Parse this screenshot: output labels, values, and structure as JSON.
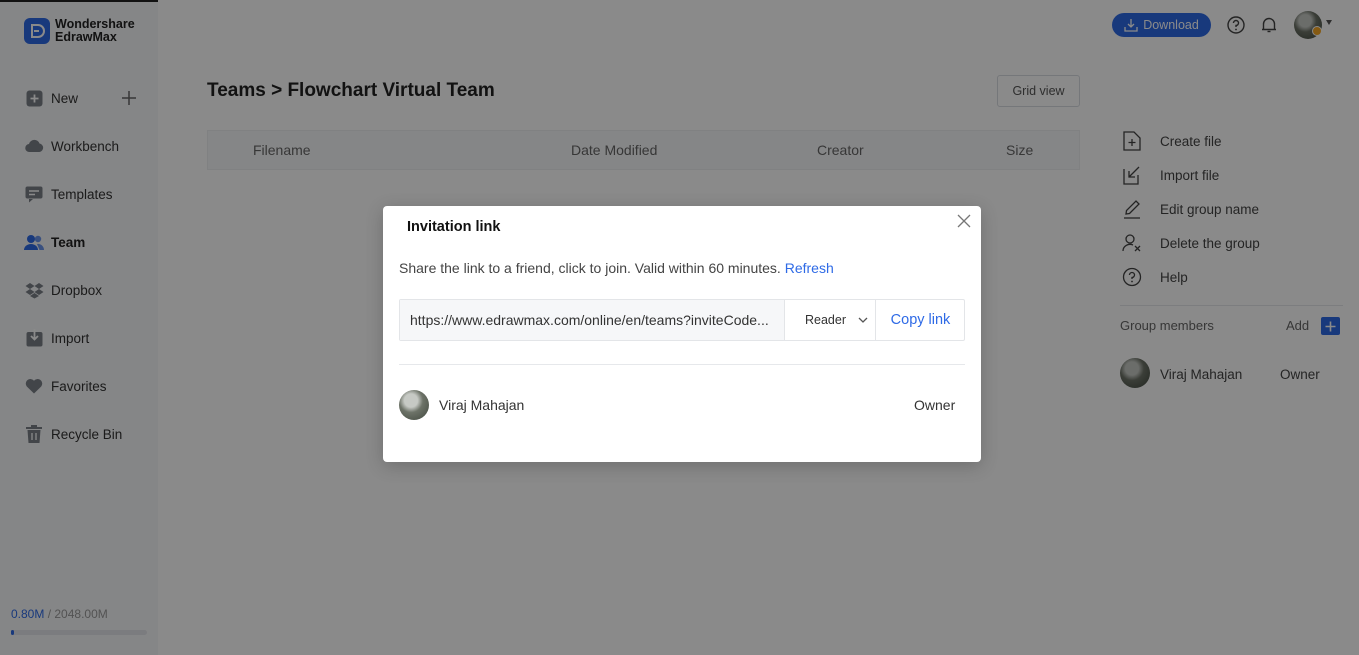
{
  "app": {
    "logo_line1": "Wondershare",
    "logo_line2": "EdrawMax",
    "accent": "#2e6ae6"
  },
  "sidebar": {
    "items": [
      {
        "label": "New",
        "icon": "plus-square-icon"
      },
      {
        "label": "Workbench",
        "icon": "cloud-icon"
      },
      {
        "label": "Templates",
        "icon": "templates-icon"
      },
      {
        "label": "Team",
        "icon": "team-icon",
        "active": true
      },
      {
        "label": "Dropbox",
        "icon": "dropbox-icon"
      },
      {
        "label": "Import",
        "icon": "import-icon"
      },
      {
        "label": "Favorites",
        "icon": "heart-icon"
      },
      {
        "label": "Recycle Bin",
        "icon": "trash-icon"
      }
    ],
    "storage_used": "0.80M",
    "storage_sep": " / ",
    "storage_total": "2048.00M",
    "storage_fraction": 0.0004
  },
  "topbar": {
    "download_label": "Download",
    "icons": [
      "help-icon",
      "bell-icon",
      "avatar",
      "caret-down-icon"
    ]
  },
  "main": {
    "breadcrumb": "Teams > Flowchart Virtual Team",
    "grid_view_label": "Grid view",
    "columns": [
      "Filename",
      "Date Modified",
      "Creator",
      "Size"
    ]
  },
  "right_panel": {
    "actions": [
      {
        "label": "Create file",
        "icon": "create-file-icon"
      },
      {
        "label": "Import file",
        "icon": "import-file-icon"
      },
      {
        "label": "Edit group name",
        "icon": "pen-icon"
      },
      {
        "label": "Delete the group",
        "icon": "delete-group-icon"
      },
      {
        "label": "Help",
        "icon": "help-icon"
      }
    ],
    "group_members_label": "Group members",
    "add_label": "Add",
    "members": [
      {
        "name": "Viraj Mahajan",
        "role": "Owner"
      }
    ]
  },
  "modal": {
    "title": "Invitation link",
    "description": "Share the link to a friend, click to join. Valid within 60 minutes.",
    "refresh_label": "Refresh",
    "link_value": "https://www.edrawmax.com/online/en/teams?inviteCode...",
    "role_selected": "Reader",
    "copy_label": "Copy link",
    "members": [
      {
        "name": "Viraj Mahajan",
        "role": "Owner"
      }
    ]
  }
}
